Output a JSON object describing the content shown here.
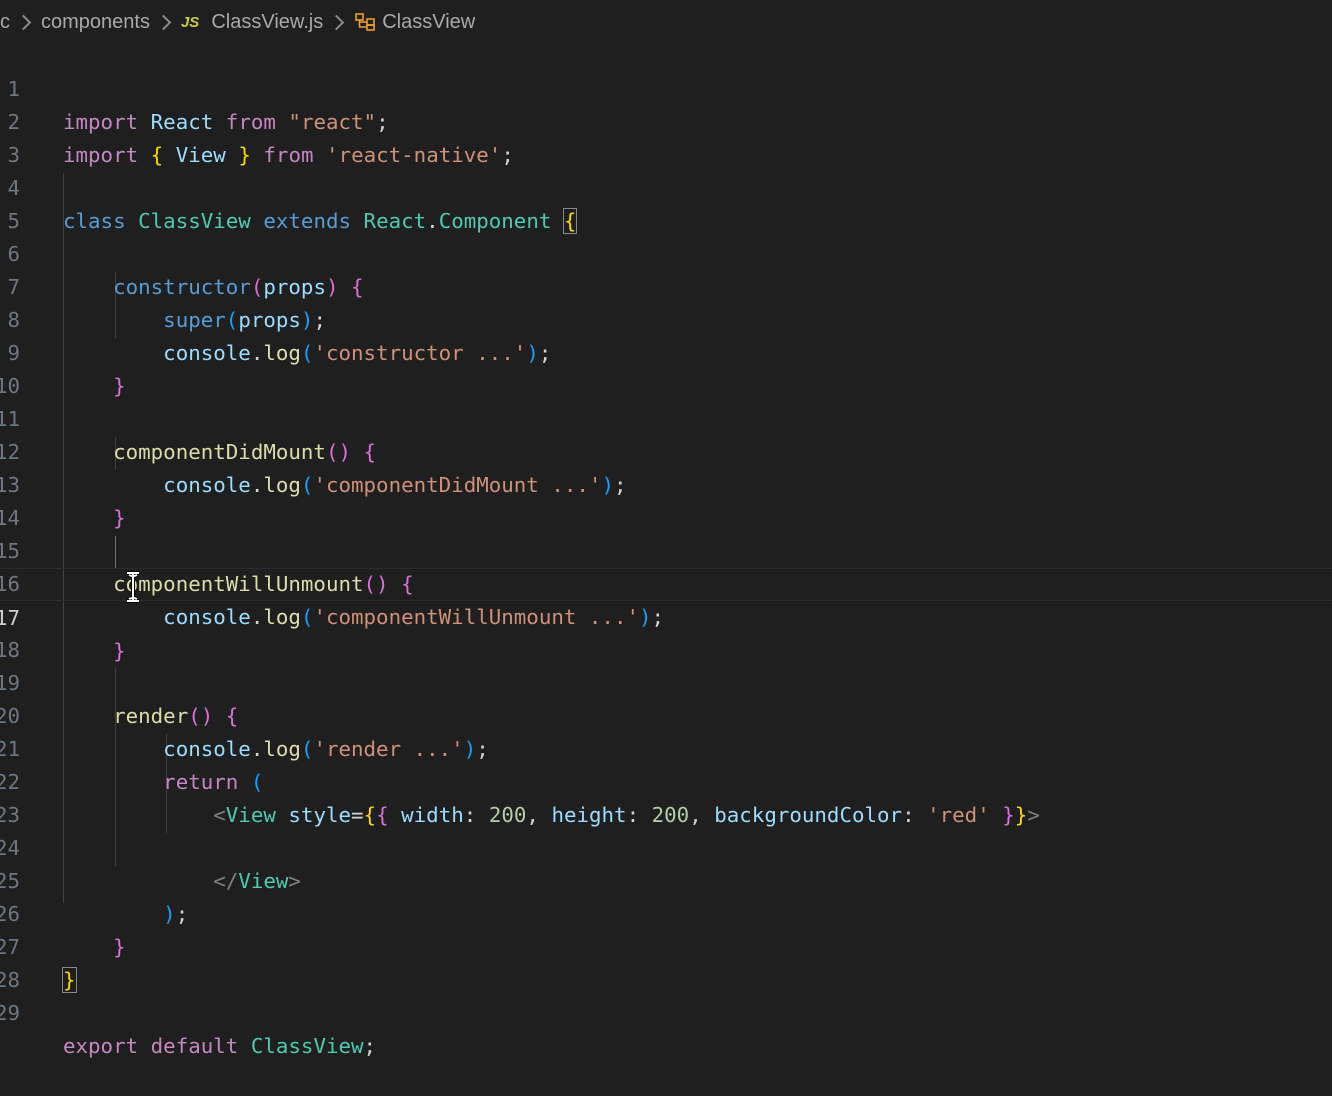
{
  "breadcrumb": {
    "root": "c",
    "folder": "components",
    "file_badge": "JS",
    "file": "ClassView.js",
    "symbol": "ClassView"
  },
  "gutter": [
    "1",
    "2",
    "3",
    "4",
    "5",
    "6",
    "7",
    "8",
    "9",
    "10",
    "11",
    "12",
    "13",
    "14",
    "15",
    "16",
    "17",
    "18",
    "19",
    "20",
    "21",
    "22",
    "23",
    "24",
    "25",
    "26",
    "27",
    "28",
    "29"
  ],
  "colors": {
    "background": "#1f1f1f",
    "keyword": "#569cd6",
    "control": "#c586c0",
    "class": "#4ec9b0",
    "function": "#dcdcaa",
    "variable": "#9cdcfe",
    "string": "#ce9178",
    "number": "#b5cea8"
  },
  "code": {
    "l1": {
      "t1": "import",
      "t2": "React",
      "t3": "from",
      "t4": "\"react\"",
      "t5": ";"
    },
    "l2": {
      "t1": "import",
      "t2": "{",
      "t3": "View",
      "t4": "}",
      "t5": "from",
      "t6": "'react-native'",
      "t7": ";"
    },
    "l4": {
      "t1": "class",
      "t2": "ClassView",
      "t3": "extends",
      "t4": "React",
      "t5": ".",
      "t6": "Component",
      "t7": "{"
    },
    "l6": {
      "t1": "constructor",
      "t2": "(",
      "t3": "props",
      "t4": ")",
      "t5": "{"
    },
    "l7": {
      "t1": "super",
      "t2": "(",
      "t3": "props",
      "t4": ")",
      "t5": ";"
    },
    "l8": {
      "t1": "console",
      "t2": ".",
      "t3": "log",
      "t4": "(",
      "t5": "'constructor ...'",
      "t6": ")",
      "t7": ";"
    },
    "l9": {
      "t1": "}"
    },
    "l11": {
      "t1": "componentDidMount",
      "t2": "()",
      "t3": "{"
    },
    "l12": {
      "t1": "console",
      "t2": ".",
      "t3": "log",
      "t4": "(",
      "t5": "'componentDidMount ...'",
      "t6": ")",
      "t7": ";"
    },
    "l13": {
      "t1": "}"
    },
    "l15": {
      "t1": "componentWillUnmount",
      "t2": "()",
      "t3": "{"
    },
    "l16": {
      "t1": "console",
      "t2": ".",
      "t3": "log",
      "t4": "(",
      "t5": "'componentWillUnmount ...'",
      "t6": ")",
      "t7": ";"
    },
    "l17": {
      "t1": "}"
    },
    "l19": {
      "t1": "render",
      "t2": "()",
      "t3": "{"
    },
    "l20": {
      "t1": "console",
      "t2": ".",
      "t3": "log",
      "t4": "(",
      "t5": "'render ...'",
      "t6": ")",
      "t7": ";"
    },
    "l21": {
      "t1": "return",
      "t2": "("
    },
    "l22": {
      "t1": "<",
      "t2": "View",
      "t3": "style",
      "t4": "=",
      "t5": "{",
      "t6": "{",
      "t7": "width",
      "t8": ":",
      "t9": "200",
      "t10": ",",
      "t11": "height",
      "t12": ":",
      "t13": "200",
      "t14": ",",
      "t15": "backgroundColor",
      "t16": ":",
      "t17": "'red'",
      "t18": "}",
      "t19": "}",
      "t20": ">"
    },
    "l24": {
      "t1": "</",
      "t2": "View",
      "t3": ">"
    },
    "l25": {
      "t1": ")",
      "t2": ";"
    },
    "l26": {
      "t1": "}"
    },
    "l27": {
      "t1": "}"
    },
    "l29": {
      "t1": "export",
      "t2": "default",
      "t3": "ClassView",
      "t4": ";"
    }
  }
}
